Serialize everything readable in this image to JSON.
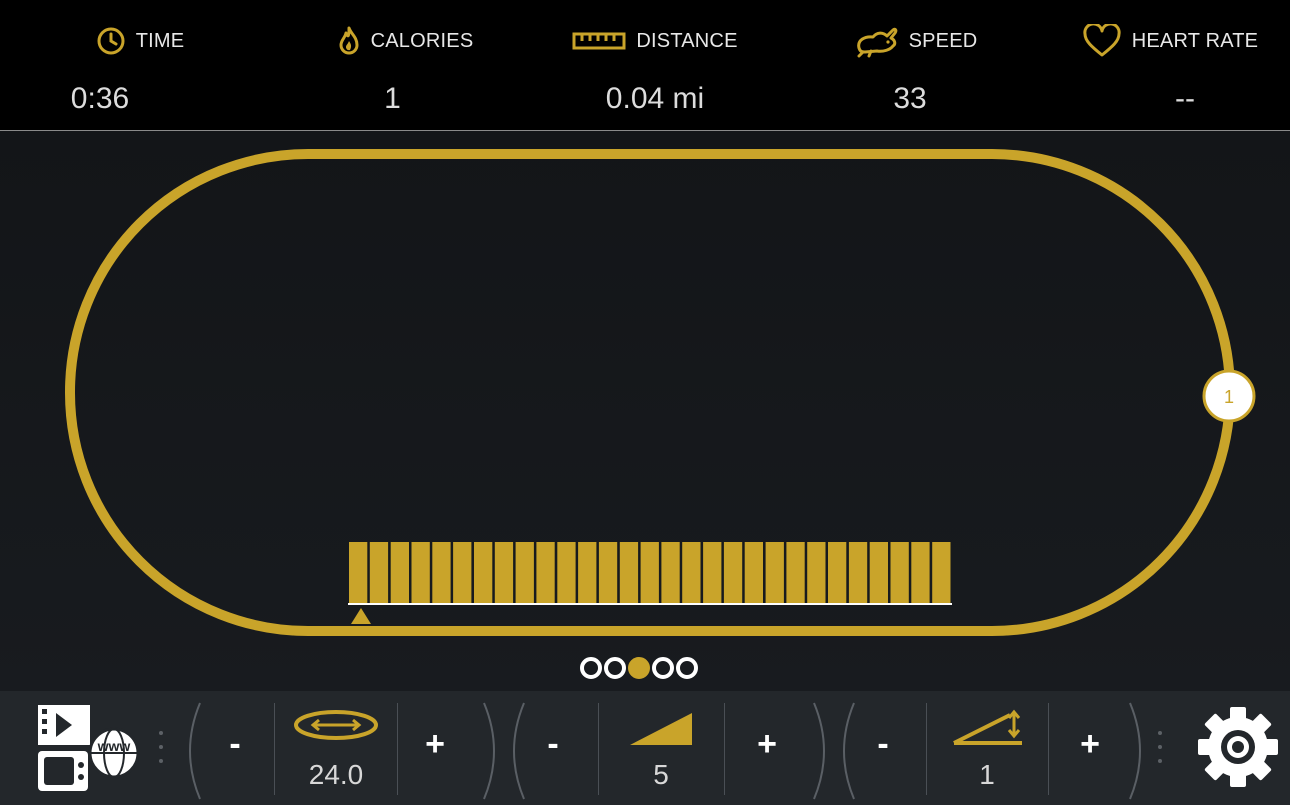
{
  "stats": [
    {
      "icon": "clock-icon",
      "label": "TIME",
      "value": "0:36"
    },
    {
      "icon": "flame-icon",
      "label": "CALORIES",
      "value": "1"
    },
    {
      "icon": "ruler-icon",
      "label": "DISTANCE",
      "value": "0.04 mi"
    },
    {
      "icon": "rabbit-icon",
      "label": "SPEED",
      "value": "33"
    },
    {
      "icon": "heart-icon",
      "label": "HEART RATE",
      "value": "--"
    }
  ],
  "track": {
    "lap_marker": "1",
    "progress_segments": 29
  },
  "pager": {
    "count": 5,
    "active_index": 2
  },
  "controls": {
    "minus_label": "-",
    "plus_label": "+",
    "speed": {
      "icon": "oval-track-icon",
      "value": "24.0"
    },
    "resistance": {
      "icon": "incline-wedge-icon",
      "value": "5"
    },
    "incline": {
      "icon": "angle-icon",
      "value": "1"
    }
  },
  "colors": {
    "accent": "#c9a42a",
    "background": "#121417",
    "topbar": "#000000",
    "bottom_bar": "#23272b"
  }
}
